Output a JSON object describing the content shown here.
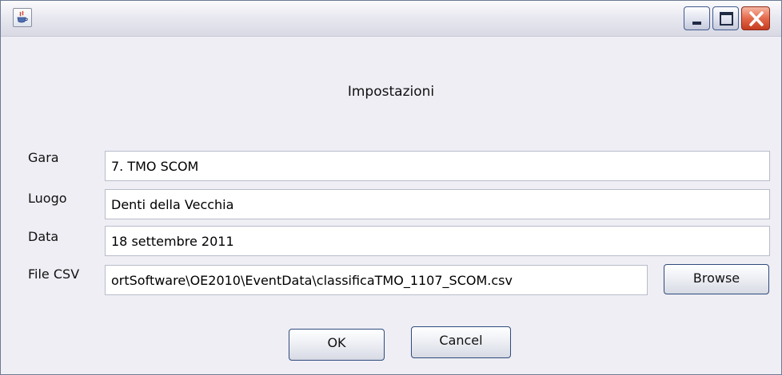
{
  "window": {
    "title": "",
    "controls": {
      "minimize_icon": "minimize-icon",
      "maximize_icon": "maximize-icon",
      "close_icon": "close-icon"
    },
    "app_icon": "java-cup-icon"
  },
  "dialog": {
    "heading": "Impostazioni",
    "fields": [
      {
        "label": "Gara",
        "value": "7. TMO SCOM"
      },
      {
        "label": "Luogo",
        "value": "Denti della Vecchia"
      },
      {
        "label": "Data",
        "value": "18 settembre 2011"
      },
      {
        "label": "File CSV",
        "value": "ortSoftware\\OE2010\\EventData\\classificaTMO_1107_SCOM.csv"
      }
    ],
    "browse_label": "Browse",
    "ok_label": "OK",
    "cancel_label": "Cancel"
  },
  "colors": {
    "background": "#eeeef4",
    "close_button": "#d9512f",
    "button_border": "#2f4b7c"
  }
}
